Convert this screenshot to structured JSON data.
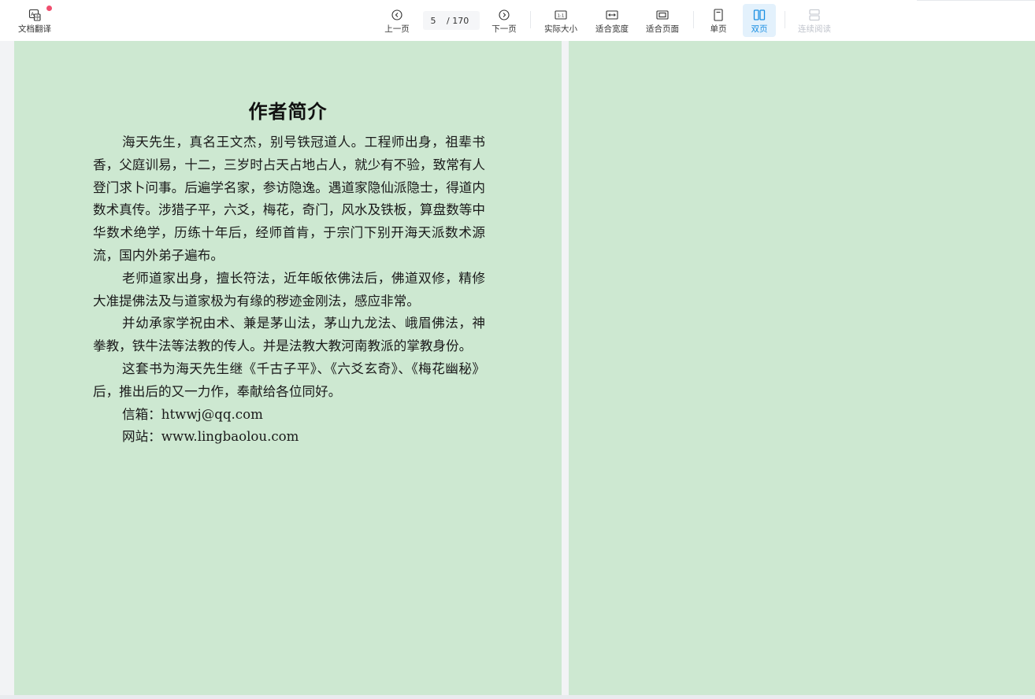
{
  "toolbar": {
    "translate_label": "文档翻译",
    "prev_label": "上一页",
    "next_label": "下一页",
    "current_page": "5",
    "total_pages": "/ 170",
    "actual_size_label": "实际大小",
    "fit_width_label": "适合宽度",
    "fit_page_label": "适合页面",
    "single_page_label": "单页",
    "double_page_label": "双页",
    "continuous_label": "连续阅读",
    "accent_color": "#1a8fe3",
    "badge_color": "#f04e6e"
  },
  "document": {
    "page_background": "#cde8d1",
    "title": "作者简介",
    "paragraphs": [
      "海天先生，真名王文杰，别号铁冠道人。工程师出身，祖辈书香，父庭训易，十二，三岁时占天占地占人，就少有不验，致常有人登门求卜问事。后遍学名家，参访隐逸。遇道家隐仙派隐士，得道内数术真传。涉猎子平，六爻，梅花，奇门，风水及铁板，算盘数等中华数术绝学，历练十年后，经师首肯，于宗门下别开海天派数术源流，国内外弟子遍布。",
      "老师道家出身，擅长符法，近年皈依佛法后，佛道双修，精修大准提佛法及与道家极为有缘的秽迹金刚法，感应非常。",
      "并幼承家学祝由术、兼是茅山法，茅山九龙法、峨眉佛法，神拳教，铁牛法等法教的传人。并是法教大教河南教派的掌教身份。",
      "这套书为海天先生继《千古子平》、《六爻玄奇》、《梅花幽秘》后，推出后的又一力作，奉献给各位同好。",
      "信箱：htwwj@qq.com",
      "网站：www.lingbaolou.com"
    ]
  }
}
